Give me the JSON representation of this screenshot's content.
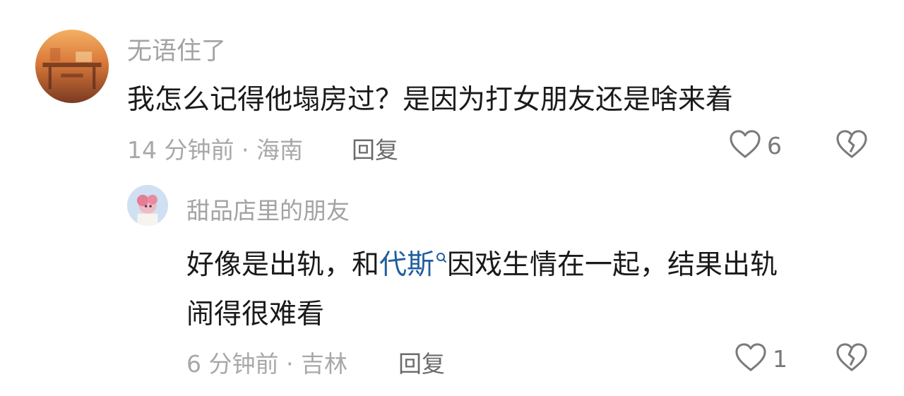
{
  "comments": [
    {
      "username": "无语住了",
      "content": "我怎么记得他塌房过？是因为打女朋友还是啥来着",
      "time": "14 分钟前",
      "location": "海南",
      "reply_label": "回复",
      "like_count": "6"
    }
  ],
  "replies": [
    {
      "username": "甜品店里的朋友",
      "content_before": "好像是出轨，和",
      "link_text": "代斯",
      "content_after_line1": "因戏生情在一起，结果出轨",
      "content_line2": "闹得很难看",
      "time": "6 分钟前",
      "location": "吉林",
      "reply_label": "回复",
      "like_count": "1"
    }
  ],
  "separator": "·",
  "icons": {
    "like": "heart-outline-icon",
    "dislike": "broken-heart-icon",
    "search": "search-icon"
  },
  "colors": {
    "username": "#a3a3a3",
    "content": "#1a1a1a",
    "meta": "#a8a8a8",
    "link": "#1f5f9e"
  }
}
